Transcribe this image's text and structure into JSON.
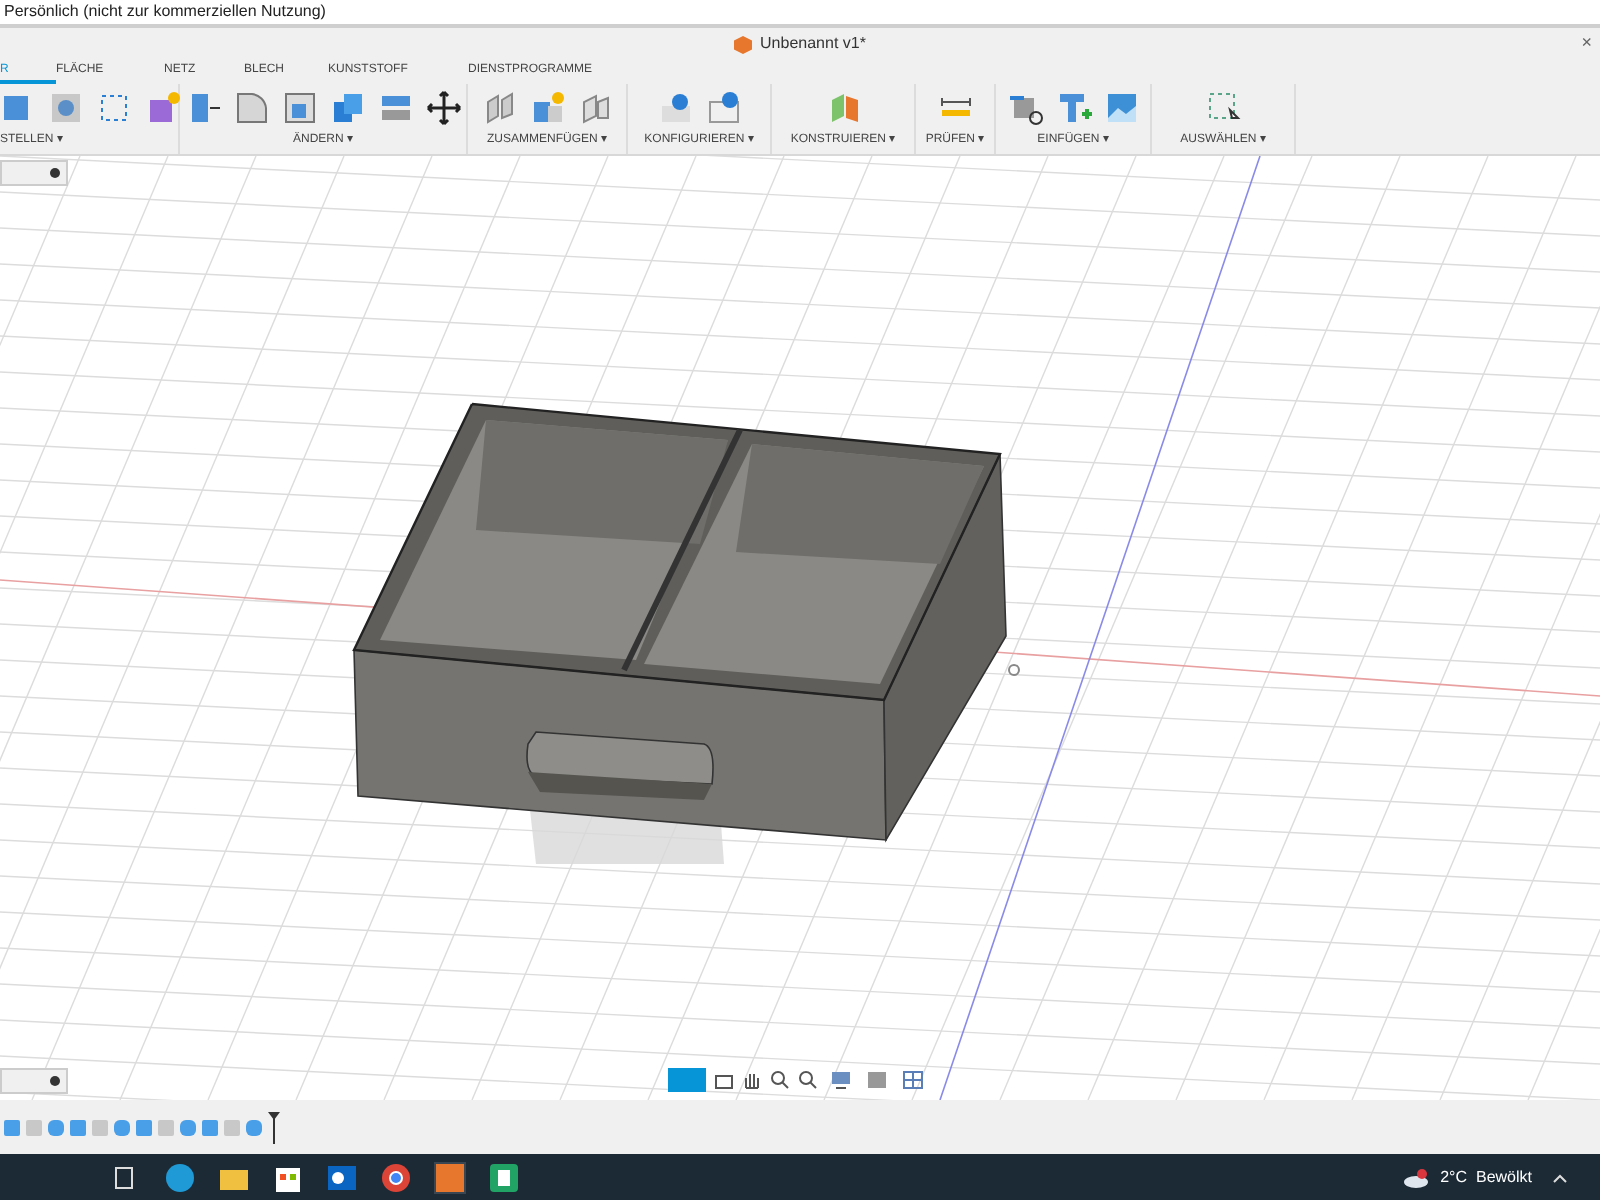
{
  "title_bar": {
    "title": "Persönlich (nicht zur kommerziellen Nutzung)"
  },
  "document_tab": {
    "title": "Unbenannt v1*",
    "close": "×"
  },
  "tabs": [
    {
      "label": "R",
      "selected": true
    },
    {
      "label": "FLÄCHE",
      "selected": false
    },
    {
      "label": "NETZ",
      "selected": false
    },
    {
      "label": "BLECH",
      "selected": false
    },
    {
      "label": "KUNSTSTOFF",
      "selected": false
    },
    {
      "label": "DIENSTPROGRAMME",
      "selected": false
    }
  ],
  "toolbar_groups": [
    {
      "label": "STELLEN ▾"
    },
    {
      "label": "ÄNDERN ▾"
    },
    {
      "label": "ZUSAMMENFÜGEN ▾"
    },
    {
      "label": "KONFIGURIEREN ▾"
    },
    {
      "label": "KONSTRUIEREN ▾"
    },
    {
      "label": "PRÜFEN ▾"
    },
    {
      "label": "EINFÜGEN ▾"
    },
    {
      "label": "AUSWÄHLEN ▾"
    }
  ],
  "taskbar": {
    "weather": "2°C  Bewölkt"
  }
}
